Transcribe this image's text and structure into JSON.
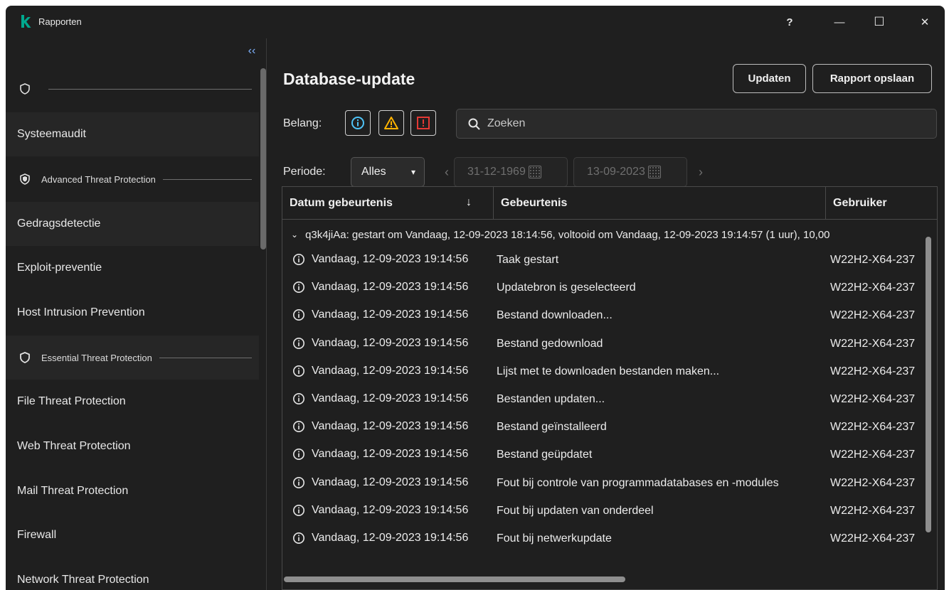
{
  "window": {
    "title": "Rapporten",
    "help": "?",
    "minimize": "—",
    "maximize": "☐",
    "close": "✕"
  },
  "sidebar": {
    "collapse": "‹‹",
    "top_group_label": "",
    "items": [
      {
        "label": "Systeemaudit"
      },
      {
        "label": "Gedragsdetectie"
      },
      {
        "label": "Exploit-preventie"
      },
      {
        "label": "Host Intrusion Prevention"
      },
      {
        "label": "File Threat Protection"
      },
      {
        "label": "Web Threat Protection"
      },
      {
        "label": "Mail Threat Protection"
      },
      {
        "label": "Firewall"
      },
      {
        "label": "Network Threat Protection"
      }
    ],
    "groups": [
      {
        "label": "Advanced Threat Protection"
      },
      {
        "label": "Essential Threat Protection"
      }
    ]
  },
  "main": {
    "title": "Database-update",
    "update_button": "Updaten",
    "save_report_button": "Rapport opslaan",
    "severity_label": "Belang:",
    "search_placeholder": "Zoeken",
    "period_label": "Periode:",
    "period_value": "Alles",
    "date_from": "31-12-1969",
    "date_to": "13-09-2023",
    "prev_arrow": "‹",
    "next_arrow": "›"
  },
  "table": {
    "columns": [
      "Datum gebeurtenis",
      "Gebeurtenis",
      "Gebruiker"
    ],
    "sort_indicator": "↓",
    "group_text": "q3k4jiAa: gestart om Vandaag, 12-09-2023 18:14:56, voltooid om Vandaag, 12-09-2023 19:14:57 (1 uur), 10,00",
    "rows": [
      {
        "date": "Vandaag, 12-09-2023 19:14:56",
        "event": "Taak gestart",
        "user": "W22H2-X64-237"
      },
      {
        "date": "Vandaag, 12-09-2023 19:14:56",
        "event": "Updatebron is geselecteerd",
        "user": "W22H2-X64-237"
      },
      {
        "date": "Vandaag, 12-09-2023 19:14:56",
        "event": "Bestand downloaden...",
        "user": "W22H2-X64-237"
      },
      {
        "date": "Vandaag, 12-09-2023 19:14:56",
        "event": "Bestand gedownload",
        "user": "W22H2-X64-237"
      },
      {
        "date": "Vandaag, 12-09-2023 19:14:56",
        "event": "Lijst met te downloaden bestanden maken...",
        "user": "W22H2-X64-237"
      },
      {
        "date": "Vandaag, 12-09-2023 19:14:56",
        "event": "Bestanden updaten...",
        "user": "W22H2-X64-237"
      },
      {
        "date": "Vandaag, 12-09-2023 19:14:56",
        "event": "Bestand geïnstalleerd",
        "user": "W22H2-X64-237"
      },
      {
        "date": "Vandaag, 12-09-2023 19:14:56",
        "event": "Bestand geüpdatet",
        "user": "W22H2-X64-237"
      },
      {
        "date": "Vandaag, 12-09-2023 19:14:56",
        "event": "Fout bij controle van programmadatabases en -modules",
        "user": "W22H2-X64-237"
      },
      {
        "date": "Vandaag, 12-09-2023 19:14:56",
        "event": "Fout bij updaten van onderdeel",
        "user": "W22H2-X64-237"
      },
      {
        "date": "Vandaag, 12-09-2023 19:14:56",
        "event": "Fout bij netwerkupdate",
        "user": "W22H2-X64-237"
      }
    ]
  },
  "colors": {
    "background": "#1f1f1f",
    "info": "#4fc3f7",
    "warning": "#ffb300",
    "critical": "#e53935",
    "logo": "#00a88e"
  }
}
